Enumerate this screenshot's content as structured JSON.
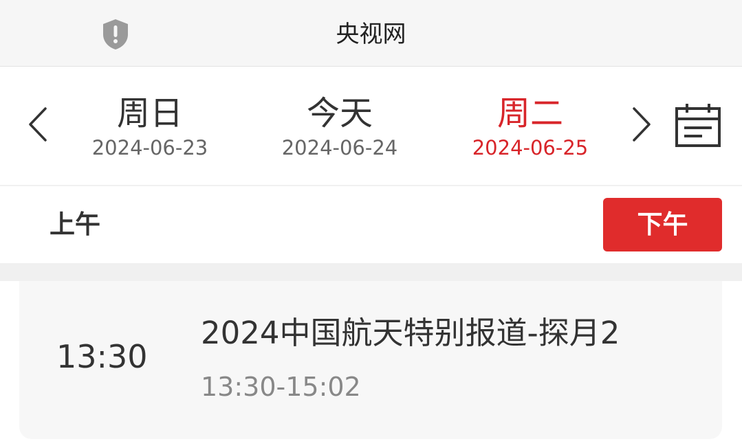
{
  "header": {
    "title": "央视网",
    "security_icon": "shield-alert-icon"
  },
  "date_nav": {
    "prev_icon": "chevron-left-icon",
    "next_icon": "chevron-right-icon",
    "calendar_icon": "calendar-icon",
    "days": [
      {
        "name": "周日",
        "date": "2024-06-23",
        "selected": false
      },
      {
        "name": "今天",
        "date": "2024-06-24",
        "selected": false
      },
      {
        "name": "周二",
        "date": "2024-06-25",
        "selected": true
      }
    ]
  },
  "period": {
    "am_label": "上午",
    "pm_label": "下午",
    "active": "pm"
  },
  "programs": [
    {
      "start": "13:30",
      "title": "2024中国航天特别报道-探月2",
      "range": "13:30-15:02"
    }
  ],
  "colors": {
    "accent": "#e02c2c",
    "selected_text": "#d8252a",
    "topbar_bg": "#f6f6f6",
    "card_bg": "#f7f7f7"
  }
}
